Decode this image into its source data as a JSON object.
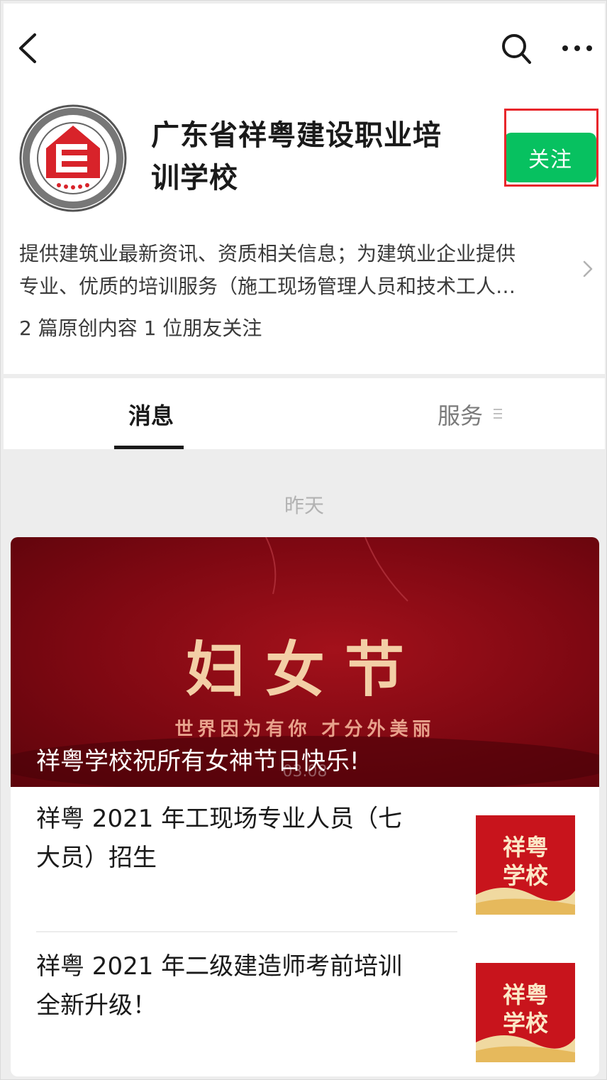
{
  "account": {
    "name": "广东省祥粤建设职业培训学校",
    "name_line1": "广东省祥粤建设职业培",
    "name_line2": "训学校",
    "follow_label": "关注",
    "description_line1": "提供建筑业最新资讯、资质相关信息；为建筑业企业提供",
    "description_line2": "专业、优质的培训服务（施工现场管理人员和技术工人…",
    "stats": "2 篇原创内容  1 位朋友关注",
    "brand_color": "#07c160",
    "highlight_color": "#e8262b"
  },
  "tabs": {
    "messages_label": "消息",
    "services_label": "服务"
  },
  "feed": {
    "date_label": "昨天",
    "banner": {
      "headline": "妇女节",
      "slogan": "世界因为有你  才分外美丽",
      "date_mark": "03.08",
      "caption": "祥粤学校祝所有女神节日快乐!"
    },
    "articles": [
      {
        "title_line1": "祥粤 2021 年工现场专业人员（七",
        "title_line2": "大员）招生",
        "thumb_text_1": "祥粤",
        "thumb_text_2": "学校"
      },
      {
        "title_line1": "祥粤 2021 年二级建造师考前培训",
        "title_line2": "全新升级！",
        "thumb_text_1": "祥粤",
        "thumb_text_2": "学校"
      }
    ]
  },
  "icons": {
    "back": "back-icon",
    "search": "search-icon",
    "more": "more-icon",
    "arrow": "chevron-right-icon",
    "menu": "menu-icon"
  }
}
